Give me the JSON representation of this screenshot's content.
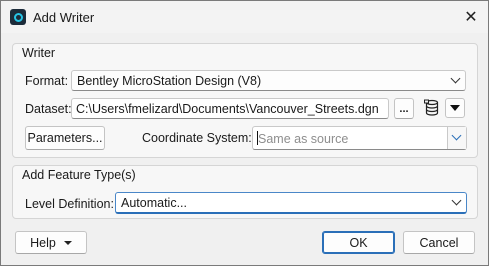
{
  "window": {
    "title": "Add Writer",
    "close_glyph": "✕"
  },
  "writer": {
    "group_label": "Writer",
    "format_label": "Format:",
    "format_value": "Bentley MicroStation Design (V8)",
    "dataset_label": "Dataset:",
    "dataset_value": "C:\\Users\\fmelizard\\Documents\\Vancouver_Streets.dgn",
    "browse_label": "...",
    "parameters_label": "Parameters...",
    "coord_system_label": "Coordinate System:",
    "coord_system_placeholder": "Same as source"
  },
  "feature_types": {
    "group_label": "Add Feature Type(s)",
    "level_def_label": "Level Definition:",
    "level_def_value": "Automatic..."
  },
  "footer": {
    "help_label": "Help",
    "ok_label": "OK",
    "cancel_label": "Cancel"
  },
  "icons": {
    "app": "fme-app-icon",
    "close": "close-icon",
    "dataset_stack": "database-stack-icon",
    "dataset_menu": "triangle-down-icon"
  },
  "colors": {
    "accent": "#2a6fb8",
    "app_icon_bg": "#1c2b3a",
    "app_icon_ring": "#27c4e6"
  }
}
